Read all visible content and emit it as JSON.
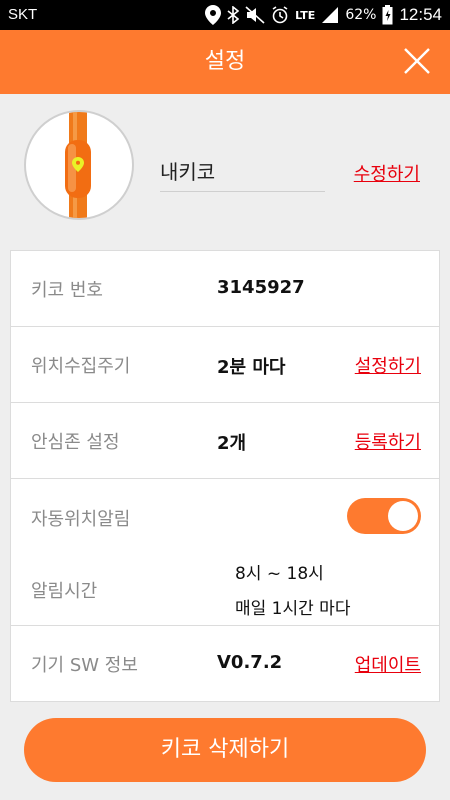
{
  "status_bar": {
    "carrier": "SKT",
    "network": "LTE",
    "battery_percent": "62%",
    "time": "12:54",
    "icons": [
      "location-icon",
      "bluetooth-icon",
      "mute-icon",
      "alarm-icon",
      "signal-icon",
      "battery-icon"
    ]
  },
  "header": {
    "title": "설정",
    "close_icon": "close-icon"
  },
  "profile": {
    "device_name": "내키코",
    "edit_label": "수정하기"
  },
  "settings": {
    "device_number": {
      "label": "키코 번호",
      "value": "3145927"
    },
    "collect_interval": {
      "label": "위치수집주기",
      "value": "2분 마다",
      "action": "설정하기"
    },
    "safe_zone": {
      "label": "안심존 설정",
      "value": "2개",
      "action": "등록하기"
    },
    "auto_alert": {
      "label": "자동위치알림",
      "enabled": true
    },
    "alert_time": {
      "label": "알림시간",
      "range": "8시 ~ 18시",
      "frequency": "매일 1시간 마다"
    },
    "sw_info": {
      "label": "기기 SW 정보",
      "value": "V0.7.2",
      "action": "업데이트"
    }
  },
  "delete_button": {
    "label": "키코 삭제하기"
  },
  "colors": {
    "accent": "#fe7a2f",
    "link": "#e8000d"
  }
}
